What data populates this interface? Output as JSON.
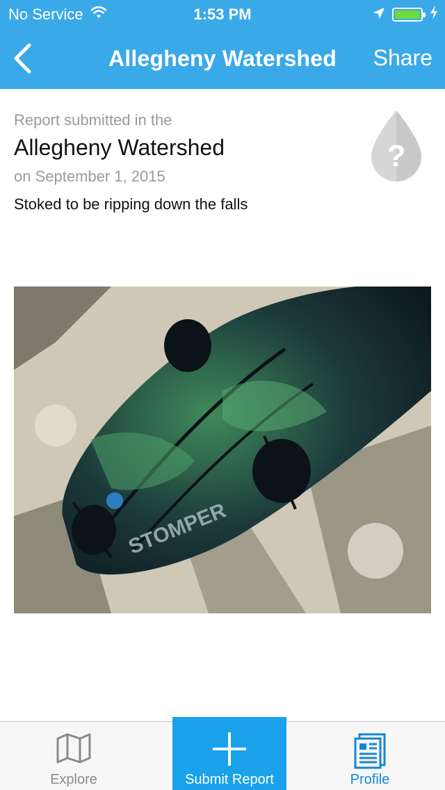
{
  "status_bar": {
    "carrier": "No Service",
    "time": "1:53 PM"
  },
  "nav": {
    "title": "Allegheny Watershed",
    "share_label": "Share"
  },
  "report": {
    "kicker": "Report submitted in the",
    "watershed": "Allegheny Watershed",
    "date": "on September 1, 2015",
    "text": "Stoked to be ripping down the falls"
  },
  "photo": {
    "brand_text": "STOMPER"
  },
  "tabs": [
    {
      "label": "Explore",
      "icon": "map-icon"
    },
    {
      "label": "Submit Report",
      "icon": "plus-icon"
    },
    {
      "label": "Profile",
      "icon": "newspaper-icon"
    }
  ],
  "colors": {
    "nav_background": "#3aa9e8",
    "submit_tab_background": "#19a2ea",
    "profile_tab_active": "#1487d3",
    "battery_fill": "#6ddc3c"
  }
}
